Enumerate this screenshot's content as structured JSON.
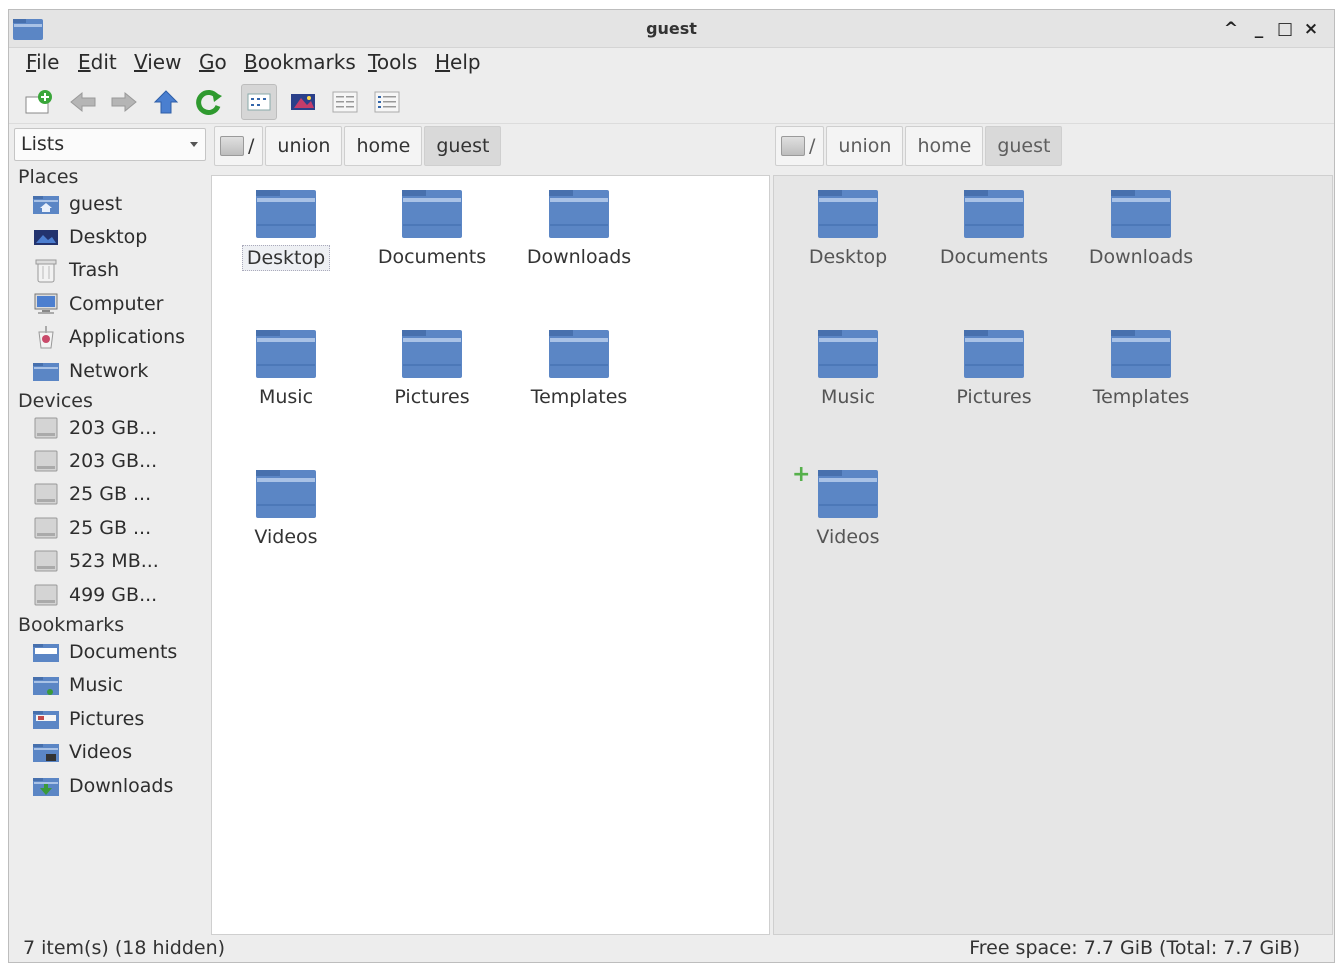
{
  "window": {
    "title": "guest"
  },
  "menu": [
    {
      "u": "F",
      "rest": "ile"
    },
    {
      "u": "E",
      "rest": "dit"
    },
    {
      "u": "V",
      "rest": "iew"
    },
    {
      "u": "G",
      "rest": "o"
    },
    {
      "u": "B",
      "rest": "ookmarks"
    },
    {
      "u": "T",
      "rest": "ools"
    },
    {
      "u": "H",
      "rest": "elp"
    }
  ],
  "side_select": {
    "value": "Lists"
  },
  "sidebar": {
    "places_title": "Places",
    "places": [
      {
        "label": "guest",
        "icon": "home-folder-icon"
      },
      {
        "label": "Desktop",
        "icon": "desktop-icon"
      },
      {
        "label": "Trash",
        "icon": "trash-icon"
      },
      {
        "label": "Computer",
        "icon": "computer-icon"
      },
      {
        "label": "Applications",
        "icon": "applications-icon"
      },
      {
        "label": "Network",
        "icon": "network-folder-icon"
      }
    ],
    "devices_title": "Devices",
    "devices": [
      {
        "label": "203 GB..."
      },
      {
        "label": "203 GB..."
      },
      {
        "label": "25 GB ..."
      },
      {
        "label": "25 GB ..."
      },
      {
        "label": "523 MB..."
      },
      {
        "label": "499 GB..."
      }
    ],
    "bookmarks_title": "Bookmarks",
    "bookmarks": [
      {
        "label": "Documents"
      },
      {
        "label": "Music"
      },
      {
        "label": "Pictures"
      },
      {
        "label": "Videos"
      },
      {
        "label": "Downloads"
      }
    ]
  },
  "path_left": [
    "/",
    "union",
    "home",
    "guest"
  ],
  "path_right": [
    "/",
    "union",
    "home",
    "guest"
  ],
  "files": [
    "Desktop",
    "Documents",
    "Downloads",
    "Music",
    "Pictures",
    "Templates",
    "Videos"
  ],
  "status": {
    "items": "7 item(s) (18 hidden)",
    "free_space": "Free space: 7.7 GiB (Total: 7.7 GiB)"
  }
}
